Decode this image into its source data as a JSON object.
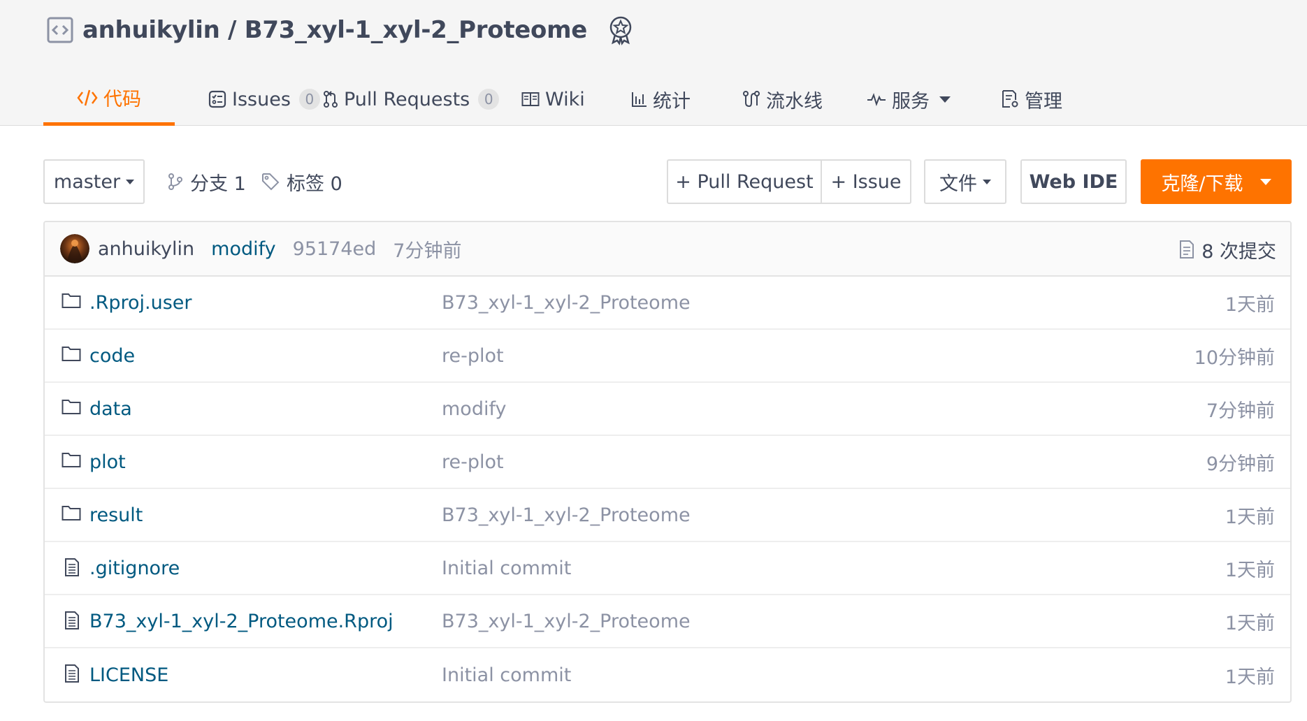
{
  "repo": {
    "owner": "anhuikylin",
    "separator": " / ",
    "name": "B73_xyl-1_xyl-2_Proteome"
  },
  "nav": {
    "code": "代码",
    "issues": "Issues",
    "issues_count": "0",
    "pulls": "Pull Requests",
    "pulls_count": "0",
    "wiki": "Wiki",
    "stats": "统计",
    "pipeline": "流水线",
    "services": "服务",
    "manage": "管理"
  },
  "toolbar": {
    "branch": "master",
    "branches_label": "分支 1",
    "tags_label": "标签 0",
    "new_pr": "+ Pull Request",
    "new_issue": "+ Issue",
    "file": "文件",
    "web_ide": "Web IDE",
    "clone": "克隆/下载"
  },
  "commit": {
    "author": "anhuikylin",
    "message": "modify",
    "sha": "95174ed",
    "time": "7分钟前",
    "count_label": "8 次提交"
  },
  "files": [
    {
      "type": "folder",
      "name": ".Rproj.user",
      "message": "B73_xyl-1_xyl-2_Proteome",
      "time": "1天前"
    },
    {
      "type": "folder",
      "name": "code",
      "message": "re-plot",
      "time": "10分钟前"
    },
    {
      "type": "folder",
      "name": "data",
      "message": "modify",
      "time": "7分钟前"
    },
    {
      "type": "folder",
      "name": "plot",
      "message": "re-plot",
      "time": "9分钟前"
    },
    {
      "type": "folder",
      "name": "result",
      "message": "B73_xyl-1_xyl-2_Proteome",
      "time": "1天前"
    },
    {
      "type": "file",
      "name": ".gitignore",
      "message": "Initial commit",
      "time": "1天前"
    },
    {
      "type": "file",
      "name": "B73_xyl-1_xyl-2_Proteome.Rproj",
      "message": "B73_xyl-1_xyl-2_Proteome",
      "time": "1天前"
    },
    {
      "type": "file",
      "name": "LICENSE",
      "message": "Initial commit",
      "time": "1天前"
    }
  ],
  "colors": {
    "accent": "#fe7300",
    "link": "#005980",
    "muted": "#8c92a4",
    "text": "#40485b"
  },
  "icons": {
    "repo": "code-repo-icon",
    "badge": "award-badge-icon",
    "folder": "folder-icon",
    "file": "file-text-icon"
  }
}
